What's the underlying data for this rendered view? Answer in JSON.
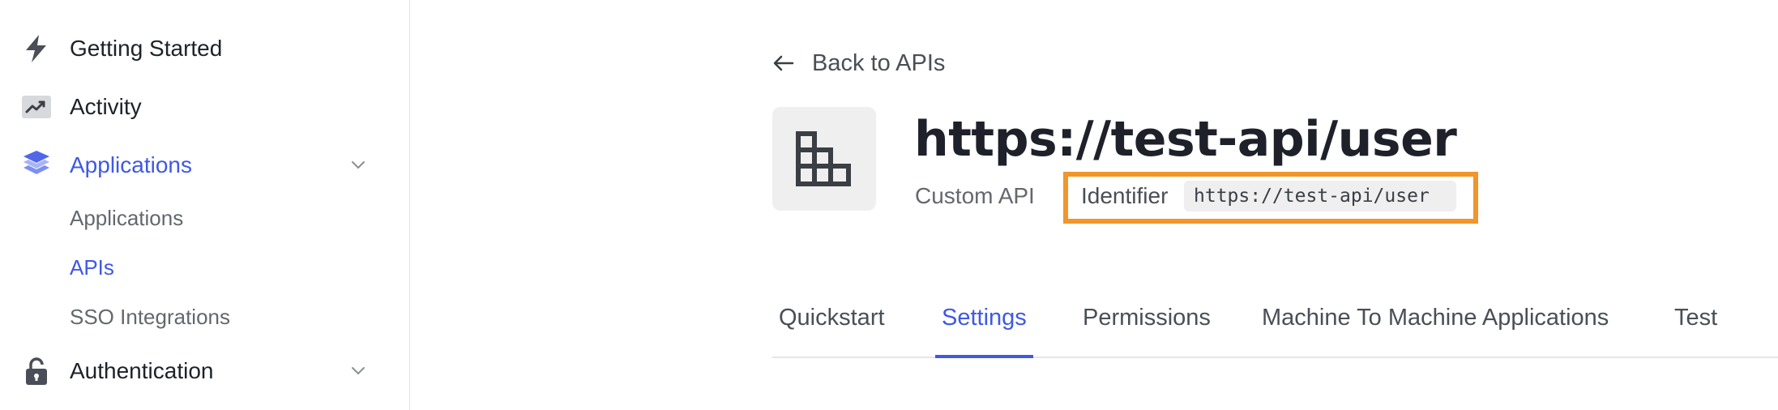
{
  "sidebar": {
    "items": [
      {
        "label": "Getting Started",
        "icon": "lightning-icon"
      },
      {
        "label": "Activity",
        "icon": "activity-chart-icon"
      },
      {
        "label": "Applications",
        "icon": "layers-icon",
        "expanded": true,
        "active": true,
        "children": [
          {
            "label": "Applications"
          },
          {
            "label": "APIs",
            "active": true
          },
          {
            "label": "SSO Integrations"
          }
        ]
      },
      {
        "label": "Authentication",
        "icon": "lock-icon",
        "expanded": false
      }
    ]
  },
  "main": {
    "back_label": "Back to APIs",
    "api": {
      "title": "https://test-api/user",
      "type": "Custom API",
      "identifier_label": "Identifier",
      "identifier_value": "https://test-api/user"
    },
    "tabs": [
      {
        "label": "Quickstart"
      },
      {
        "label": "Settings",
        "active": true
      },
      {
        "label": "Permissions"
      },
      {
        "label": "Machine To Machine Applications"
      },
      {
        "label": "Test"
      }
    ]
  },
  "colors": {
    "accent": "#3f59e4",
    "highlight_box": "#f0962b",
    "text_primary": "#1e212a",
    "text_secondary": "#65676e"
  }
}
